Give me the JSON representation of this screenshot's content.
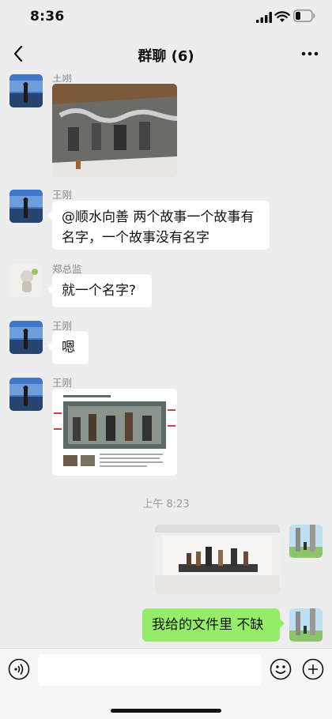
{
  "status": {
    "time": "8:36"
  },
  "nav": {
    "title": "群聊 (6)"
  },
  "messages": [
    {
      "sender": "王刚",
      "type": "image"
    },
    {
      "sender": "王刚",
      "text": "@顺水向善 两个故事一个故事有名字，一个故事没有名字"
    },
    {
      "sender": "郑总监",
      "text": "就一个名字?"
    },
    {
      "sender": "王刚",
      "text": "嗯"
    },
    {
      "sender": "王刚",
      "type": "image"
    },
    {
      "timestamp": "上午 8:23"
    },
    {
      "sender": "self",
      "type": "image"
    },
    {
      "sender": "self",
      "text": "我给的文件里 不缺"
    }
  ],
  "composer": {
    "placeholder": ""
  },
  "colors": {
    "background": "#ededed",
    "self_bubble": "#95ec69",
    "other_bubble": "#ffffff"
  },
  "icons": [
    "back-icon",
    "more-icon",
    "voice-icon",
    "emoji-icon",
    "plus-icon",
    "signal-icon",
    "wifi-icon",
    "battery-icon"
  ]
}
